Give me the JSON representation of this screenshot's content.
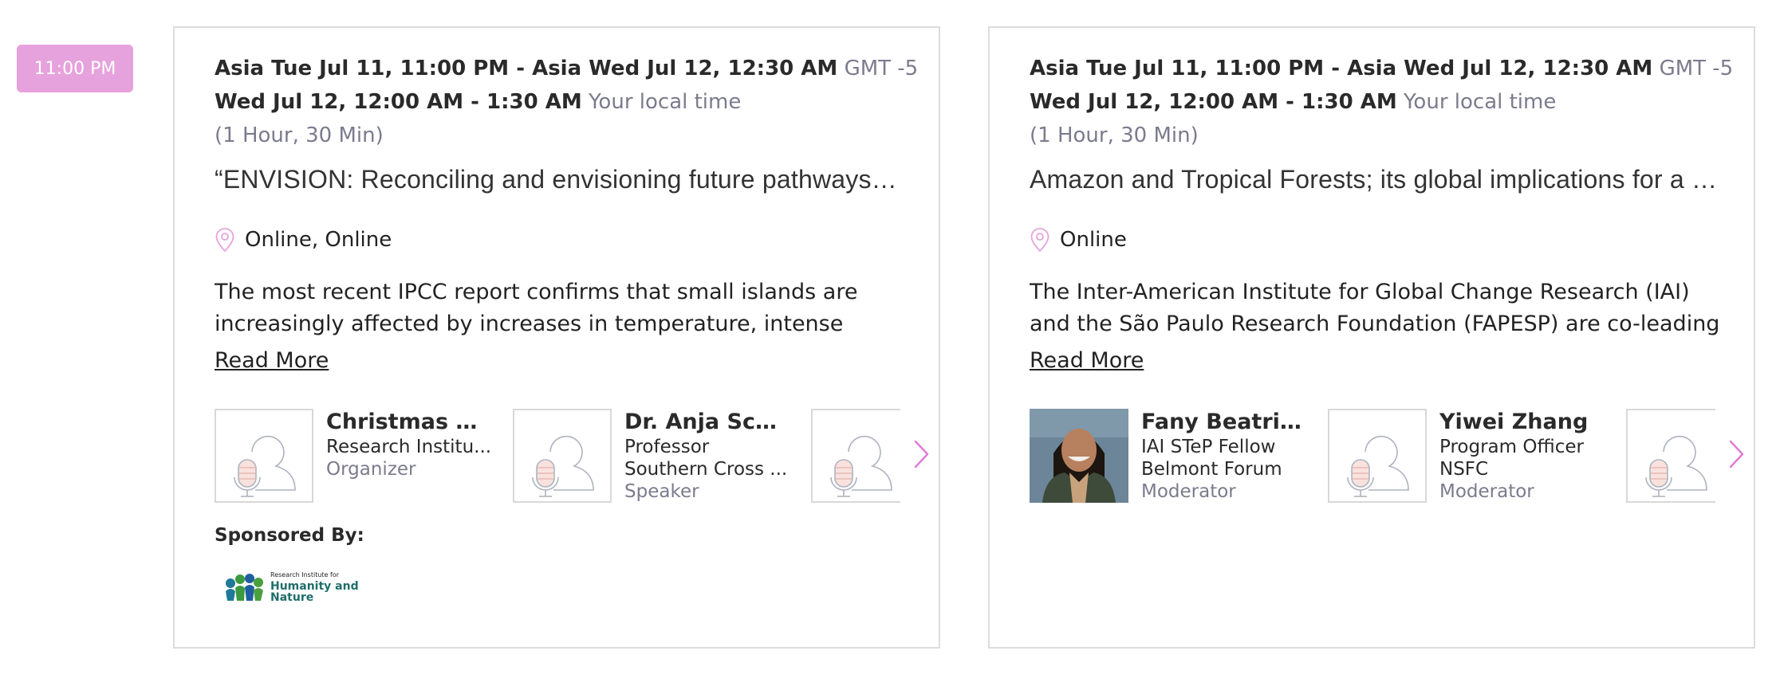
{
  "timeslot": {
    "label": "11:00 PM"
  },
  "colors": {
    "accent": "#e6a2dc",
    "muted": "#7b7b8e",
    "border": "#dcdcdc"
  },
  "events": [
    {
      "line1_bold": "Asia Tue Jul 11, 11:00 PM - Asia Wed Jul 12, 12:30 AM",
      "line1_muted": "GMT -5",
      "line2_bold": "Wed Jul 12, 12:00 AM - 1:30 AM",
      "line2_muted": "Your local time",
      "duration": "(1 Hour, 30 Min)",
      "title": "“ENVISION: Reconciling and envisioning future pathways for…",
      "location_icon": "map-pin-icon",
      "location": "Online, Online",
      "description": "The most recent IPCC report confirms that small islands are increasingly affected by increases in temperature, intense tropical cyclones, storm",
      "read_more": "Read More",
      "speakers": [
        {
          "name": "Christmas Uc...",
          "line1": "Research Institu...",
          "line2": "",
          "role": "Organizer",
          "photo": false
        },
        {
          "name": "Dr. Anja Sche...",
          "line1": "Professor",
          "line2": "Southern Cross ...",
          "role": "Speaker",
          "photo": false
        },
        {
          "name": "",
          "line1": "",
          "line2": "",
          "role": "",
          "photo": false
        }
      ],
      "next_icon": "chevron-right-icon",
      "sponsored_by": "Sponsored By:",
      "sponsor": {
        "small": "Research Institute for",
        "big1": "Humanity and",
        "big2": "Nature"
      }
    },
    {
      "line1_bold": "Asia Tue Jul 11, 11:00 PM - Asia Wed Jul 12, 12:30 AM",
      "line1_muted": "GMT -5",
      "line2_bold": "Wed Jul 12, 12:00 AM - 1:30 AM",
      "line2_muted": "Your local time",
      "duration": "(1 Hour, 30 Min)",
      "title": "Amazon and Tropical Forests; its global implications for a s…",
      "location_icon": "map-pin-icon",
      "location": "Online",
      "description": "The Inter-American Institute for Global Change Research (IAI) and the São Paulo Research Foundation (FAPESP) are co-leading a new Belmont",
      "read_more": "Read More",
      "speakers": [
        {
          "name": "Fany Beatriz ...",
          "line1": "IAI STeP Fellow",
          "line2": "Belmont Forum",
          "role": "Moderator",
          "photo": true
        },
        {
          "name": "Yiwei Zhang",
          "line1": "Program Officer",
          "line2": "NSFC",
          "role": "Moderator",
          "photo": false
        },
        {
          "name": "",
          "line1": "",
          "line2": "",
          "role": "",
          "photo": false
        }
      ],
      "next_icon": "chevron-right-icon"
    }
  ]
}
